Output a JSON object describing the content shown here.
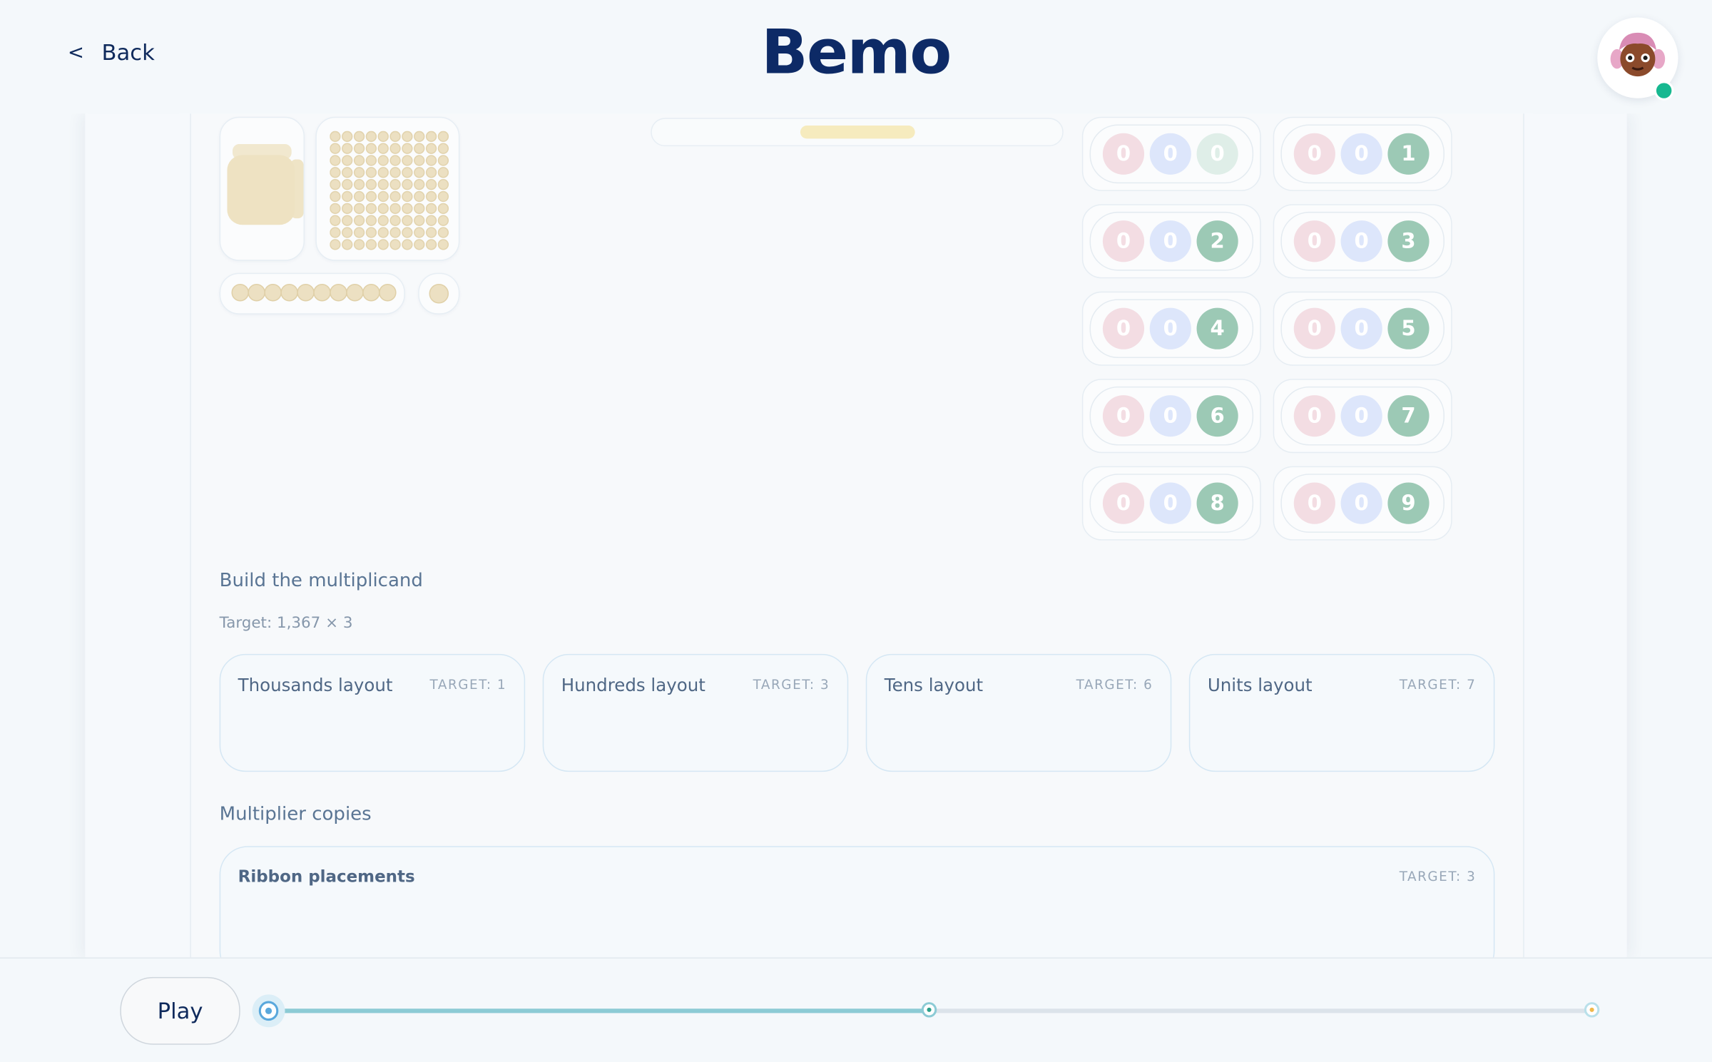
{
  "header": {
    "back_label": "Back",
    "back_chevron": "<",
    "title": "Bemo",
    "avatar_icon": "girl-avatar-icon",
    "online_color": "#17b890"
  },
  "materials": {
    "icons": [
      "cube-icon",
      "hundred-square-icon",
      "ten-bar-icon",
      "unit-bead-icon"
    ],
    "bead_color": "#ece0c2"
  },
  "progress_pill_fraction": 0.28,
  "number_cards": [
    {
      "h": "0",
      "t": "0",
      "u": "0"
    },
    {
      "h": "0",
      "t": "0",
      "u": "1"
    },
    {
      "h": "0",
      "t": "0",
      "u": "2"
    },
    {
      "h": "0",
      "t": "0",
      "u": "3"
    },
    {
      "h": "0",
      "t": "0",
      "u": "4"
    },
    {
      "h": "0",
      "t": "0",
      "u": "5"
    },
    {
      "h": "0",
      "t": "0",
      "u": "6"
    },
    {
      "h": "0",
      "t": "0",
      "u": "7"
    },
    {
      "h": "0",
      "t": "0",
      "u": "8"
    },
    {
      "h": "0",
      "t": "0",
      "u": "9"
    }
  ],
  "build": {
    "heading": "Build the multiplicand",
    "target": "Target: 1,367 × 3",
    "layouts": [
      {
        "label": "Thousands layout",
        "target": "TARGET: 1"
      },
      {
        "label": "Hundreds layout",
        "target": "TARGET: 3"
      },
      {
        "label": "Tens layout",
        "target": "TARGET: 6"
      },
      {
        "label": "Units layout",
        "target": "TARGET: 7"
      }
    ]
  },
  "multiplier": {
    "heading": "Multiplier copies",
    "ribbon_label": "Ribbon placements",
    "ribbon_target": "TARGET: 3"
  },
  "bottom": {
    "play_label": "Play",
    "timeline_progress": 0.5,
    "colors": {
      "track_done": "#8ccbd5",
      "start": "#5aa8dc",
      "end_dot": "#f0b84a"
    }
  }
}
